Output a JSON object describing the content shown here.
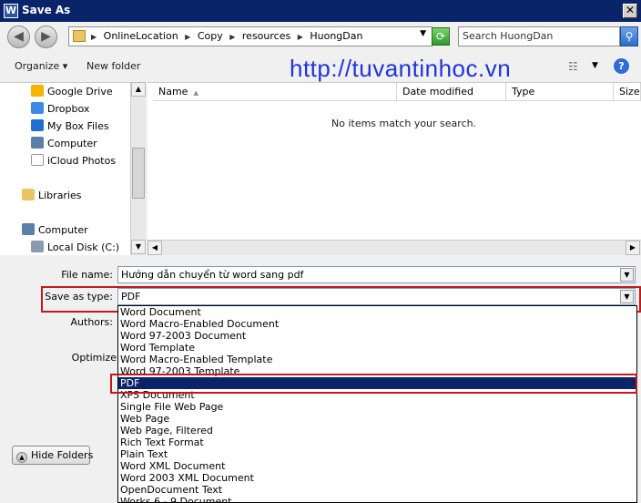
{
  "window": {
    "title": "Save As",
    "app_icon_letter": "W"
  },
  "address": {
    "crumbs": [
      "OnlineLocation",
      "Copy",
      "resources",
      "HuongDan"
    ],
    "search_placeholder": "Search HuongDan"
  },
  "toolbar": {
    "organize": "Organize ▾",
    "new_folder": "New folder",
    "watermark": "http://tuvantinhoc.vn"
  },
  "nav": {
    "items": [
      {
        "label": "Google Drive",
        "icon": "google-drive-icon",
        "color": "#f4b400"
      },
      {
        "label": "Dropbox",
        "icon": "dropbox-icon",
        "color": "#3d8ae5"
      },
      {
        "label": "My Box Files",
        "icon": "box-icon",
        "color": "#1f6fd1"
      },
      {
        "label": "Computer",
        "icon": "computer-icon",
        "color": "#5a7fa8"
      },
      {
        "label": "iCloud Photos",
        "icon": "icloud-icon",
        "color": "#ffffff"
      },
      {
        "label": "Libraries",
        "icon": "libraries-icon",
        "color": "#e8c661"
      },
      {
        "label": "Computer",
        "icon": "computer-icon",
        "color": "#5a7fa8"
      },
      {
        "label": "Local Disk (C:)",
        "icon": "disk-icon",
        "color": "#8a9bb0"
      }
    ]
  },
  "filelist": {
    "columns": [
      "Name",
      "Date modified",
      "Type",
      "Size"
    ],
    "empty_message": "No items match your search."
  },
  "form": {
    "file_name_label": "File name:",
    "file_name_value": "Hướng dẫn chuyển từ word sang pdf",
    "save_type_label": "Save as type:",
    "save_type_value": "PDF",
    "authors_label": "Authors:",
    "optimize_label": "Optimize"
  },
  "type_options": [
    "Word Document",
    "Word Macro-Enabled Document",
    "Word 97-2003 Document",
    "Word Template",
    "Word Macro-Enabled Template",
    "Word 97-2003 Template",
    "PDF",
    "XPS Document",
    "Single File Web Page",
    "Web Page",
    "Web Page, Filtered",
    "Rich Text Format",
    "Plain Text",
    "Word XML Document",
    "Word 2003 XML Document",
    "OpenDocument Text",
    "Works 6 - 9 Document"
  ],
  "selected_type_index": 6,
  "hide_folders": "Hide Folders",
  "colors": {
    "title_bar": "#0a246a",
    "highlight": "#0a246a",
    "watermark": "#1f35d8",
    "annotation": "#c21a1a"
  }
}
